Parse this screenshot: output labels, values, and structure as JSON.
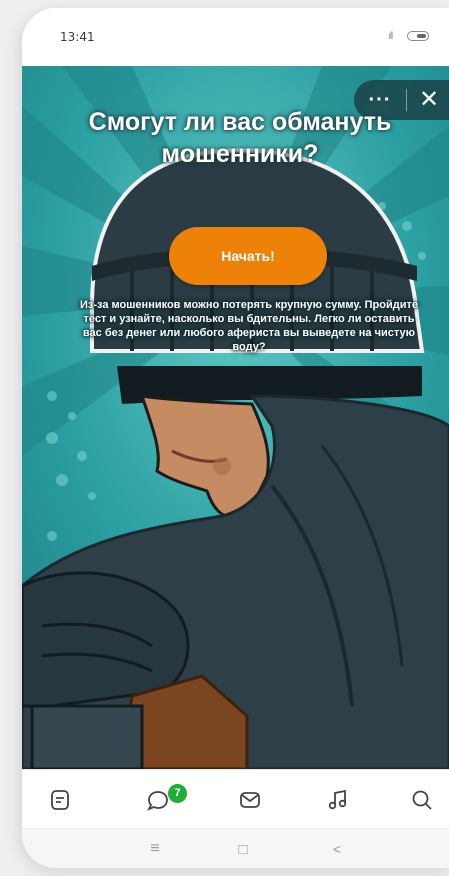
{
  "status": {
    "time": "13:41",
    "signal": "ıll"
  },
  "promo": {
    "more_label": "···",
    "close_label": "✕",
    "title": "Смогут ли вас обмануть мошенники?",
    "start_label": "Начать!",
    "description": "Из-за мошенников можно потерять крупную сумму. Пройдите тест и узнайте, насколько вы бдительны. Легко ли оставить вас без денег или любого афериста вы выведете на чистую воду?"
  },
  "tabbar": {
    "items": [
      {
        "icon": "feed-icon"
      },
      {
        "icon": "chat-icon",
        "badge": "7"
      },
      {
        "icon": "mail-icon"
      },
      {
        "icon": "music-icon"
      },
      {
        "icon": "search-icon"
      }
    ]
  },
  "navbar": {
    "menu": "≡",
    "home": "□",
    "back": "<"
  },
  "colors": {
    "accent": "#ee8208",
    "badge": "#1fae38",
    "hero_bg": "#238d93"
  }
}
